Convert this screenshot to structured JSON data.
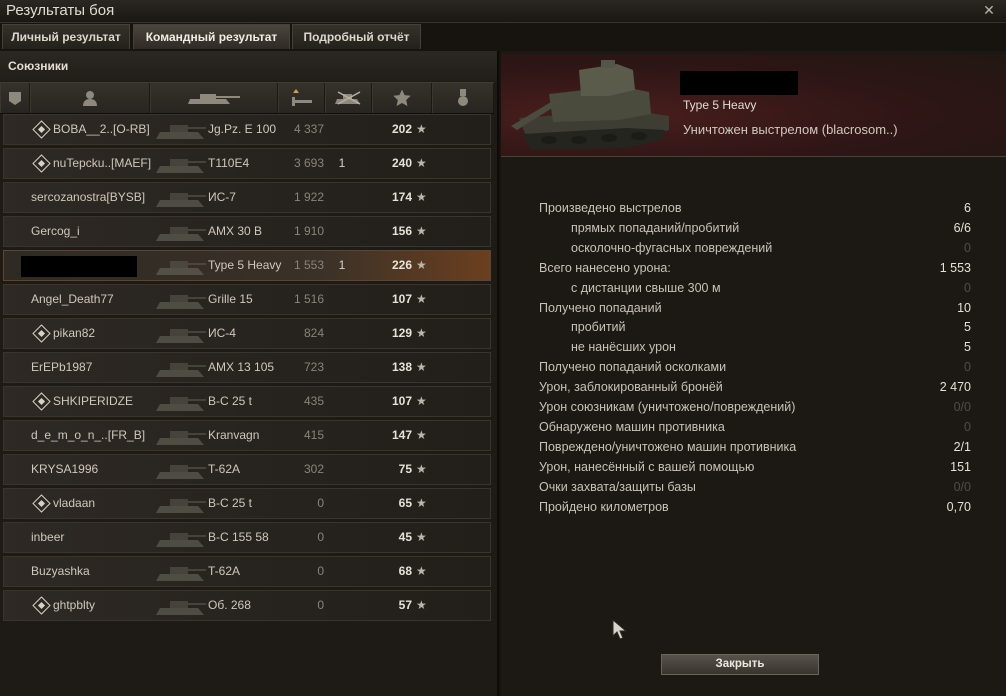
{
  "window": {
    "title": "Результаты боя",
    "close_glyph": "✕"
  },
  "tabs": [
    {
      "label": "Личный результат",
      "active": false
    },
    {
      "label": "Командный результат",
      "active": true
    },
    {
      "label": "Подробный отчёт",
      "active": false
    }
  ],
  "allies": {
    "header": "Союзники",
    "columns": [
      "platoon-icon",
      "player-icon",
      "tank-icon",
      "damage-icon",
      "kills-icon",
      "xp-star-icon",
      "medal-icon"
    ],
    "rows": [
      {
        "player": "BOBA__2..[O-RB]",
        "platoon": true,
        "vehicle": "Jg.Pz. E 100",
        "damage": "4 337",
        "kills": "",
        "xp": "202"
      },
      {
        "player": "nuTepcku..[MAEF]",
        "platoon": true,
        "vehicle": "T110E4",
        "damage": "3 693",
        "kills": "1",
        "xp": "240"
      },
      {
        "player": "sercozanostra[BYSB]",
        "platoon": false,
        "vehicle": "ИС-7",
        "damage": "1 922",
        "kills": "",
        "xp": "174"
      },
      {
        "player": "Gercog_i",
        "platoon": false,
        "vehicle": "AMX 30 B",
        "damage": "1 910",
        "kills": "",
        "xp": "156"
      },
      {
        "player": "",
        "platoon": false,
        "self": true,
        "vehicle": "Type 5 Heavy",
        "damage": "1 553",
        "kills": "1",
        "xp": "226"
      },
      {
        "player": "Angel_Death77",
        "platoon": false,
        "vehicle": "Grille 15",
        "damage": "1 516",
        "kills": "",
        "xp": "107"
      },
      {
        "player": "pikan82",
        "platoon": true,
        "vehicle": "ИС-4",
        "damage": "824",
        "kills": "",
        "xp": "129"
      },
      {
        "player": "ErEPb1987",
        "platoon": false,
        "vehicle": "AMX 13 105",
        "damage": "723",
        "kills": "",
        "xp": "138"
      },
      {
        "player": "SHKIPERIDZE",
        "platoon": true,
        "vehicle": "B-C 25 t",
        "damage": "435",
        "kills": "",
        "xp": "107"
      },
      {
        "player": "d_e_m_o_n_..[FR_B]",
        "platoon": false,
        "vehicle": "Kranvagn",
        "damage": "415",
        "kills": "",
        "xp": "147"
      },
      {
        "player": "KRYSA1996",
        "platoon": false,
        "vehicle": "T-62A",
        "damage": "302",
        "kills": "",
        "xp": "75"
      },
      {
        "player": "vladaan",
        "platoon": true,
        "vehicle": "B-C 25 t",
        "damage": "0",
        "kills": "",
        "xp": "65"
      },
      {
        "player": "inbeer",
        "platoon": false,
        "vehicle": "B-C 155 58",
        "damage": "0",
        "kills": "",
        "xp": "45"
      },
      {
        "player": "Buzyashka",
        "platoon": false,
        "vehicle": "T-62A",
        "damage": "0",
        "kills": "",
        "xp": "68"
      },
      {
        "player": "ghtpblty",
        "platoon": true,
        "vehicle": "Об. 268",
        "damage": "0",
        "kills": "",
        "xp": "57"
      }
    ],
    "star_glyph": "★"
  },
  "detail": {
    "tank_name": "Type 5 Heavy",
    "status": "Уничтожен выстрелом (blacrosom..)",
    "stats": [
      {
        "label": "Произведено выстрелов",
        "value": "6",
        "sub": false,
        "dim": false
      },
      {
        "label": "прямых попаданий/пробитий",
        "value": "6/6",
        "sub": true,
        "dim": false
      },
      {
        "label": "осколочно-фугасных повреждений",
        "value": "0",
        "sub": true,
        "dim": true
      },
      {
        "label": "Всего нанесено урона:",
        "value": "1 553",
        "sub": false,
        "dim": false
      },
      {
        "label": "с дистанции свыше 300 м",
        "value": "0",
        "sub": true,
        "dim": true
      },
      {
        "label": "Получено попаданий",
        "value": "10",
        "sub": false,
        "dim": false
      },
      {
        "label": "пробитий",
        "value": "5",
        "sub": true,
        "dim": false
      },
      {
        "label": "не нанёсших урон",
        "value": "5",
        "sub": true,
        "dim": false
      },
      {
        "label": "Получено попаданий осколками",
        "value": "0",
        "sub": false,
        "dim": true
      },
      {
        "label": "Урон, заблокированный бронёй",
        "value": "2 470",
        "sub": false,
        "dim": false
      },
      {
        "label": "Урон союзникам (уничтожено/повреждений)",
        "value": "0/0",
        "sub": false,
        "dim": true
      },
      {
        "label": "Обнаружено машин противника",
        "value": "0",
        "sub": false,
        "dim": true
      },
      {
        "label": "Повреждено/уничтожено машин противника",
        "value": "2/1",
        "sub": false,
        "dim": false
      },
      {
        "label": "Урон, нанесённый с вашей помощью",
        "value": "151",
        "sub": false,
        "dim": false
      },
      {
        "label": "Очки захвата/защиты базы",
        "value": "0/0",
        "sub": false,
        "dim": true
      },
      {
        "label": "Пройдено километров",
        "value": "0,70",
        "sub": false,
        "dim": false
      }
    ],
    "close_label": "Закрыть"
  },
  "colors": {
    "self_row_accent": "#6b3f1f",
    "dim_value": "#514b43",
    "card_bg": "#4a1e1e"
  }
}
